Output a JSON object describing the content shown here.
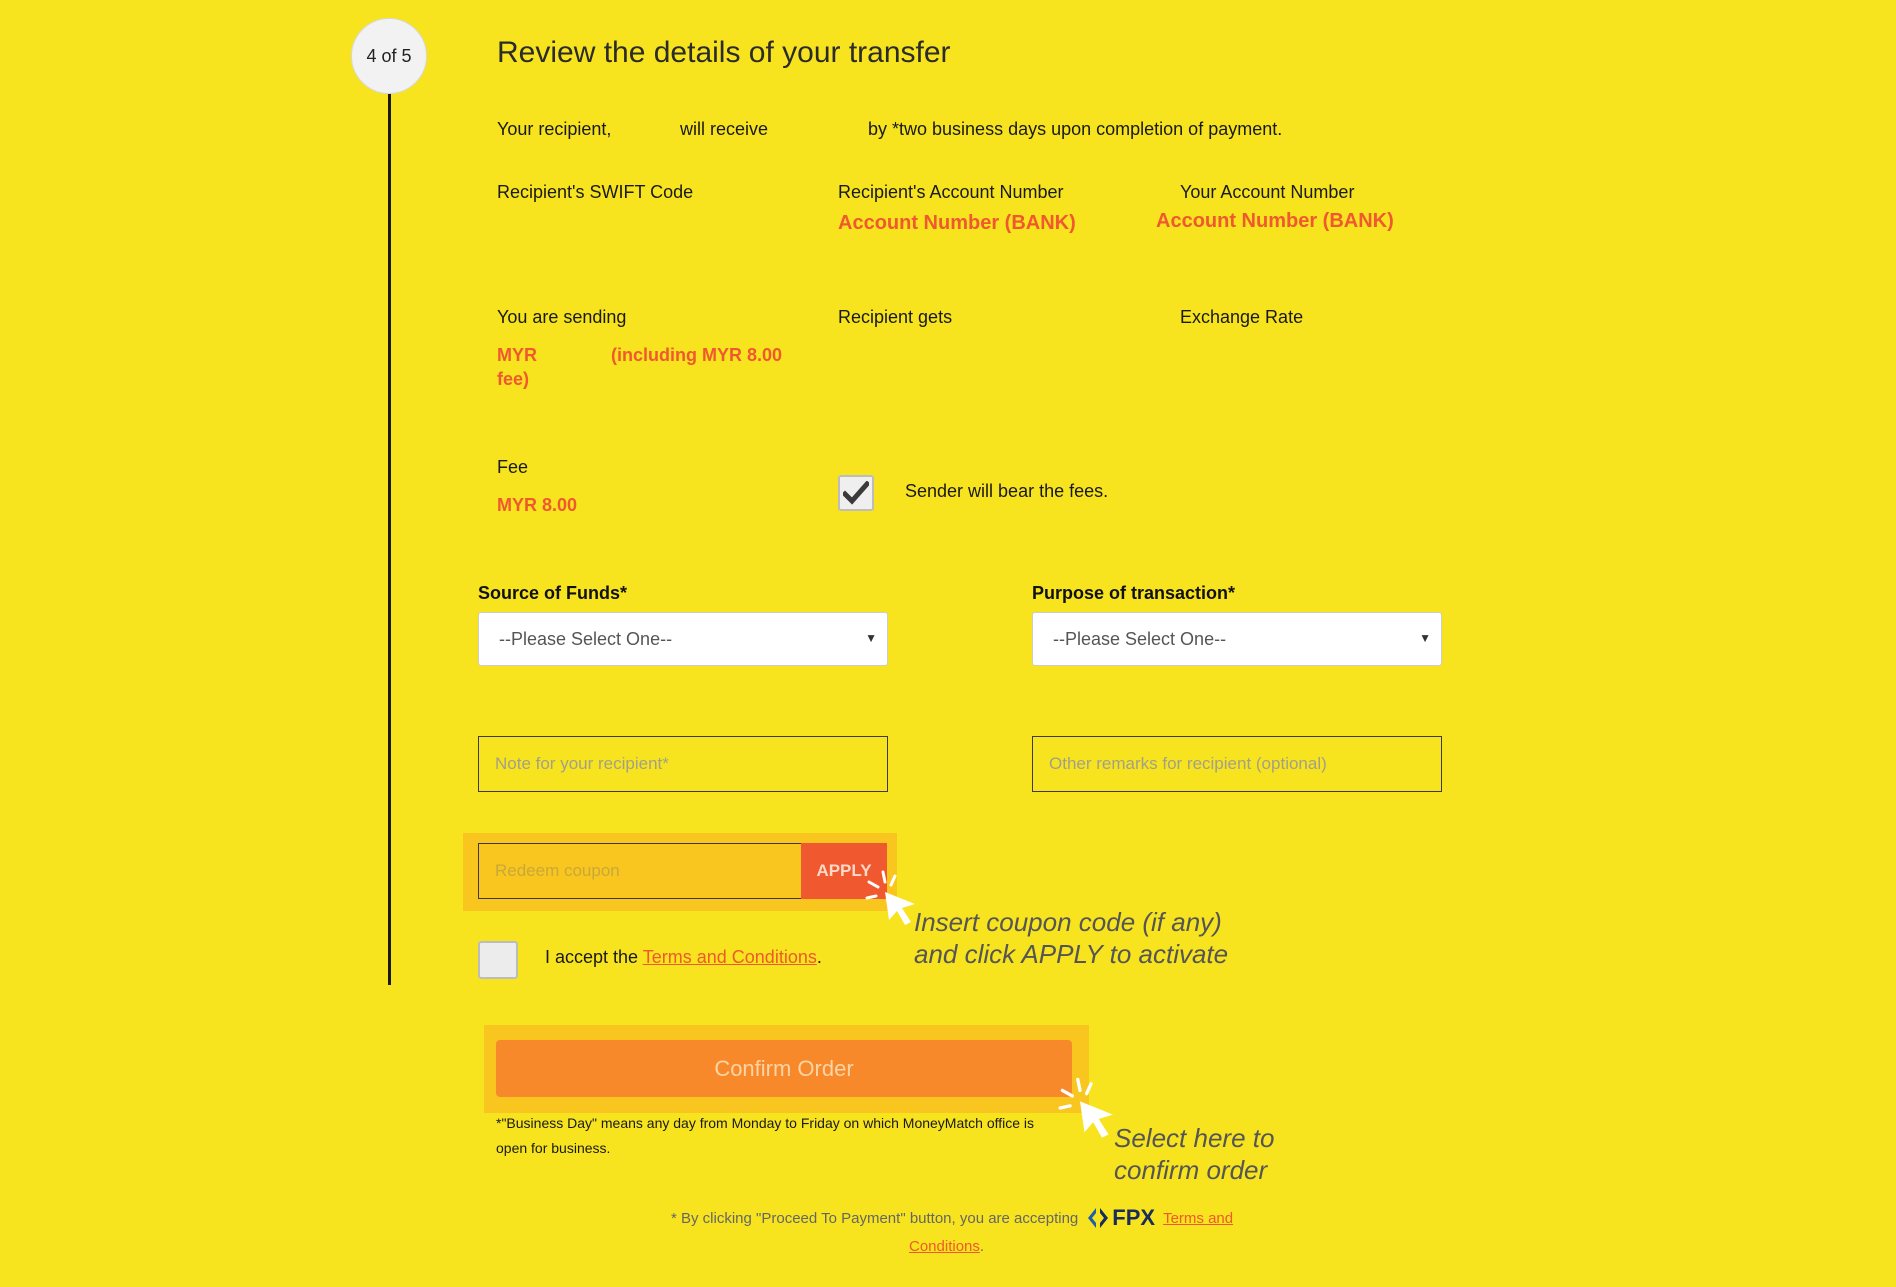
{
  "step": {
    "label": "4 of 5"
  },
  "title": "Review the details of your transfer",
  "summary": {
    "part1": "Your recipient,",
    "part2": "will receive",
    "part3": "by *two business days upon completion of payment."
  },
  "swift": {
    "label": "Recipient's SWIFT Code"
  },
  "recipient_account": {
    "label": "Recipient's Account Number",
    "value": "Account Number (BANK)"
  },
  "your_account": {
    "label": "Your Account Number",
    "value": "Account Number (BANK)"
  },
  "sending": {
    "label": "You are sending",
    "value_currency": "MYR",
    "value_fee_line1": "(including MYR 8.00",
    "value_fee_line2": "fee)"
  },
  "recipient_gets": {
    "label": "Recipient gets"
  },
  "exchange_rate": {
    "label": "Exchange Rate"
  },
  "fee": {
    "label": "Fee",
    "value": "MYR 8.00"
  },
  "sender_bear": {
    "label": "Sender will bear the fees.",
    "checked": true
  },
  "source_of_funds": {
    "label": "Source of Funds*",
    "selected": "--Please Select One--"
  },
  "purpose": {
    "label": "Purpose of transaction*",
    "selected": "--Please Select One--"
  },
  "note_recipient": {
    "placeholder": "Note for your recipient*"
  },
  "other_remarks": {
    "placeholder": "Other remarks for recipient (optional)"
  },
  "coupon": {
    "placeholder": "Redeem coupon",
    "apply_label": "APPLY"
  },
  "hints": {
    "coupon_line1": "Insert coupon code (if any)",
    "coupon_line2": "and click APPLY to activate",
    "confirm_line1": "Select here to",
    "confirm_line2": "confirm order"
  },
  "terms": {
    "prefix": "I accept the",
    "link": "Terms and Conditions",
    "suffix": "."
  },
  "confirm": {
    "label": "Confirm Order"
  },
  "business_day_note": {
    "line1": "*\"Business Day\" means any day from Monday to Friday on which MoneyMatch office is",
    "line2": "open for business."
  },
  "fpx_footer": {
    "text": "* By clicking \"Proceed To Payment\" button, you are accepting",
    "logo": "FPX",
    "link1": "Terms and",
    "link2": "Conditions",
    "suffix": "."
  },
  "colors": {
    "background": "#f7e41e",
    "accent": "#f0582f",
    "button": "#f7892b",
    "highlight": "#f9c61f"
  }
}
